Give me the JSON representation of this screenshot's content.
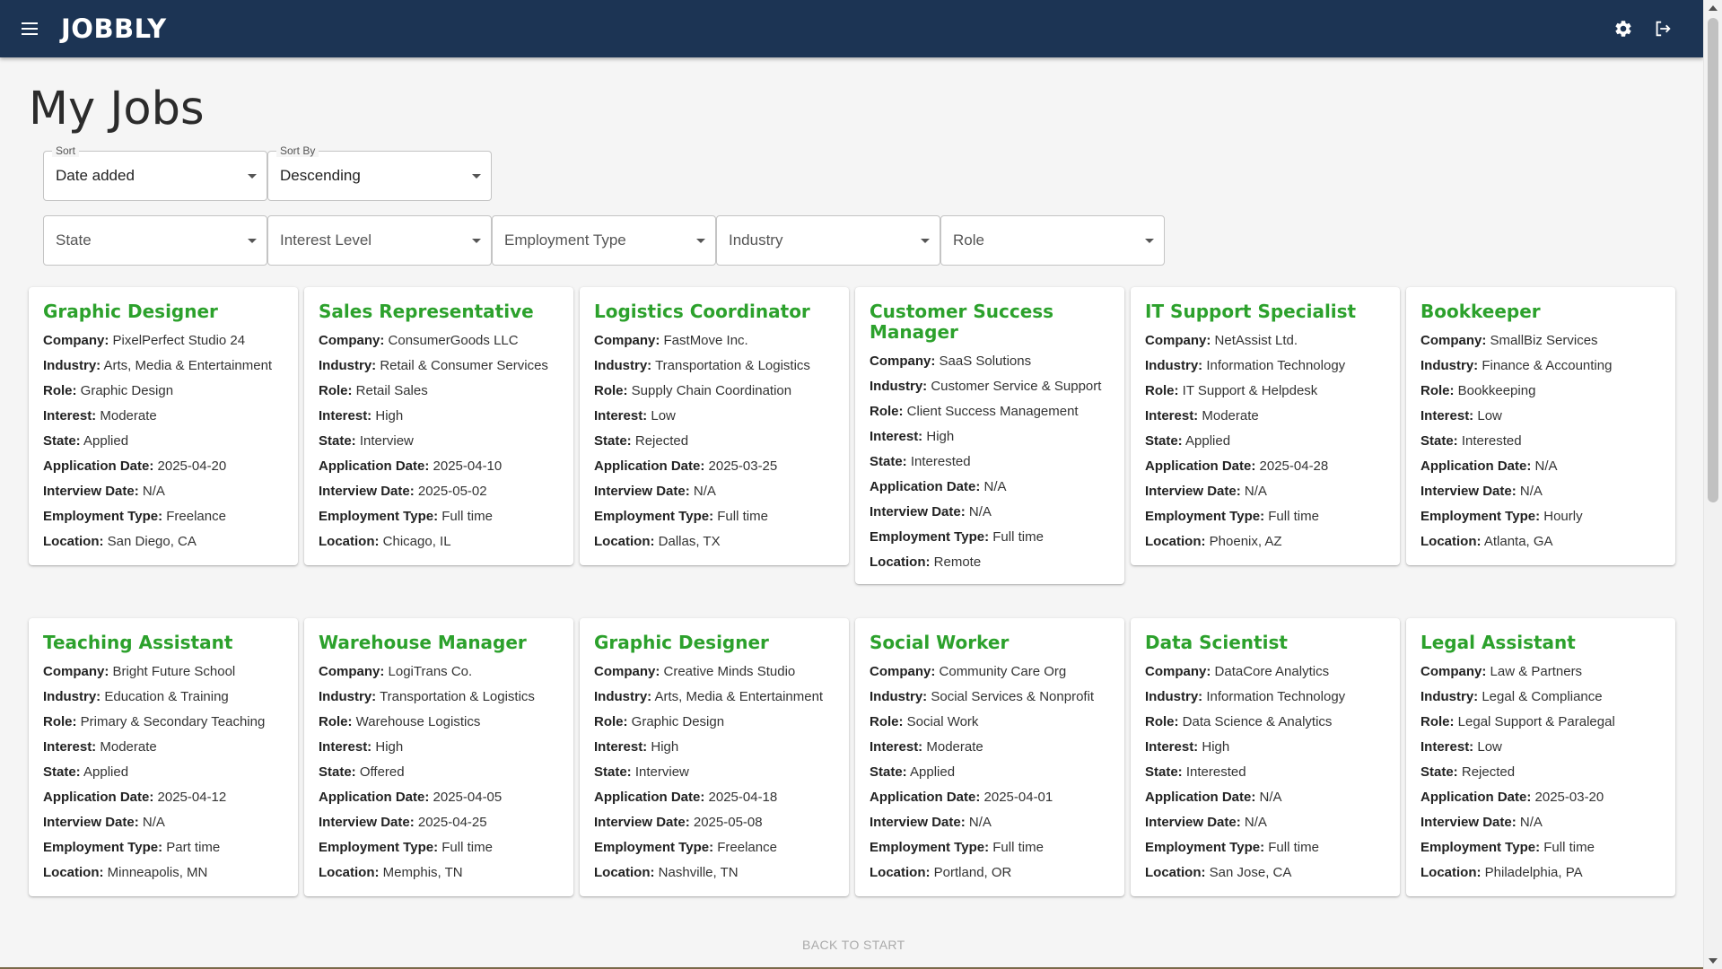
{
  "app": {
    "brand": "JOBBLY"
  },
  "icons": {
    "menu": "menu-icon",
    "settings": "gear-icon",
    "logout": "logout-icon"
  },
  "page": {
    "title": "My Jobs"
  },
  "sort": {
    "label": "Sort",
    "value": "Date added"
  },
  "sort_by": {
    "label": "Sort By",
    "value": "Descending"
  },
  "filters": [
    "State",
    "Interest Level",
    "Employment Type",
    "Industry",
    "Role"
  ],
  "field_labels": {
    "company": "Company:",
    "industry": "Industry:",
    "role": "Role:",
    "interest": "Interest:",
    "state": "State:",
    "application_date": "Application Date:",
    "interview_date": "Interview Date:",
    "employment_type": "Employment Type:",
    "location": "Location:"
  },
  "jobs": [
    {
      "title": "Graphic Designer",
      "company": "PixelPerfect Studio 24",
      "industry": "Arts, Media & Entertainment",
      "role": "Graphic Design",
      "interest": "Moderate",
      "state": "Applied",
      "application_date": "2025-04-20",
      "interview_date": "N/A",
      "employment_type": "Freelance",
      "location": "San Diego, CA"
    },
    {
      "title": "Sales Representative",
      "company": "ConsumerGoods LLC",
      "industry": "Retail & Consumer Services",
      "role": "Retail Sales",
      "interest": "High",
      "state": "Interview",
      "application_date": "2025-04-10",
      "interview_date": "2025-05-02",
      "employment_type": "Full time",
      "location": "Chicago, IL"
    },
    {
      "title": "Logistics Coordinator",
      "company": "FastMove Inc.",
      "industry": "Transportation & Logistics",
      "role": "Supply Chain Coordination",
      "interest": "Low",
      "state": "Rejected",
      "application_date": "2025-03-25",
      "interview_date": "N/A",
      "employment_type": "Full time",
      "location": "Dallas, TX"
    },
    {
      "title": "Customer Success Manager",
      "company": "SaaS Solutions",
      "industry": "Customer Service & Support",
      "role": "Client Success Management",
      "interest": "High",
      "state": "Interested",
      "application_date": "N/A",
      "interview_date": "N/A",
      "employment_type": "Full time",
      "location": "Remote"
    },
    {
      "title": "IT Support Specialist",
      "company": "NetAssist Ltd.",
      "industry": "Information Technology",
      "role": "IT Support & Helpdesk",
      "interest": "Moderate",
      "state": "Applied",
      "application_date": "2025-04-28",
      "interview_date": "N/A",
      "employment_type": "Full time",
      "location": "Phoenix, AZ"
    },
    {
      "title": "Bookkeeper",
      "company": "SmallBiz Services",
      "industry": "Finance & Accounting",
      "role": "Bookkeeping",
      "interest": "Low",
      "state": "Interested",
      "application_date": "N/A",
      "interview_date": "N/A",
      "employment_type": "Hourly",
      "location": "Atlanta, GA"
    },
    {
      "title": "Teaching Assistant",
      "company": "Bright Future School",
      "industry": "Education & Training",
      "role": "Primary & Secondary Teaching",
      "interest": "Moderate",
      "state": "Applied",
      "application_date": "2025-04-12",
      "interview_date": "N/A",
      "employment_type": "Part time",
      "location": "Minneapolis, MN"
    },
    {
      "title": "Warehouse Manager",
      "company": "LogiTrans Co.",
      "industry": "Transportation & Logistics",
      "role": "Warehouse Logistics",
      "interest": "High",
      "state": "Offered",
      "application_date": "2025-04-05",
      "interview_date": "2025-04-25",
      "employment_type": "Full time",
      "location": "Memphis, TN"
    },
    {
      "title": "Graphic Designer",
      "company": "Creative Minds Studio",
      "industry": "Arts, Media & Entertainment",
      "role": "Graphic Design",
      "interest": "High",
      "state": "Interview",
      "application_date": "2025-04-18",
      "interview_date": "2025-05-08",
      "employment_type": "Freelance",
      "location": "Nashville, TN"
    },
    {
      "title": "Social Worker",
      "company": "Community Care Org",
      "industry": "Social Services & Nonprofit",
      "role": "Social Work",
      "interest": "Moderate",
      "state": "Applied",
      "application_date": "2025-04-01",
      "interview_date": "N/A",
      "employment_type": "Full time",
      "location": "Portland, OR"
    },
    {
      "title": "Data Scientist",
      "company": "DataCore Analytics",
      "industry": "Information Technology",
      "role": "Data Science & Analytics",
      "interest": "High",
      "state": "Interested",
      "application_date": "N/A",
      "interview_date": "N/A",
      "employment_type": "Full time",
      "location": "San Jose, CA"
    },
    {
      "title": "Legal Assistant",
      "company": "Law & Partners",
      "industry": "Legal & Compliance",
      "role": "Legal Support & Paralegal",
      "interest": "Low",
      "state": "Rejected",
      "application_date": "2025-03-20",
      "interview_date": "N/A",
      "employment_type": "Full time",
      "location": "Philadelphia, PA"
    }
  ],
  "footer": {
    "back_to_start": "BACK TO START"
  },
  "colors": {
    "appbar": "#1c3454",
    "title_green": "#2ca12c",
    "background": "#f5f5f5"
  }
}
